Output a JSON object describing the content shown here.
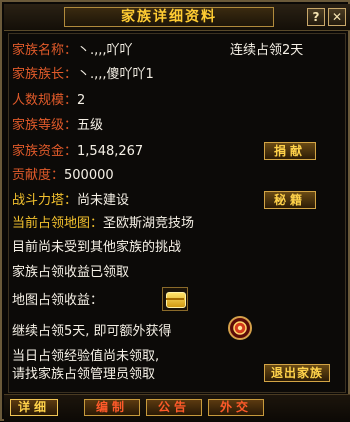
{
  "window": {
    "title": "家族详细资料",
    "help_label": "?",
    "close_label": "✕"
  },
  "info": {
    "family_name_label": "家族名称：",
    "family_name_value": "丶.,,,吖吖",
    "consecutive_label": "连续占领2天",
    "leader_label": "家族族长：",
    "leader_value": "丶.,,,傻吖吖1",
    "size_label": "人数规模：",
    "size_value": "2",
    "level_label": "家族等级：",
    "level_value": "五级",
    "funds_label": "家族资金：",
    "funds_value": "1,548,267",
    "contribution_label": "贡献度：",
    "contribution_value": "500000",
    "hall_label": "战斗力塔：",
    "hall_value": "尚未建设",
    "territory_label": "当前占领地图：",
    "territory_value": "圣欧斯湖竞技场",
    "challenge_text": "目前尚未受到其他家族的挑战",
    "income_received_text": "家族占领收益已领取",
    "map_income_label": "地图占领收益：",
    "continue_text": "继续占领5天, 即可额外获得",
    "exp_text_1": "当日占领经验值尚未领取,",
    "exp_text_2": "请找家族占领管理员领取"
  },
  "buttons": {
    "donate": "捐献",
    "secret": "秘籍",
    "leave": "退出家族"
  },
  "tabs": [
    {
      "label": "详细",
      "active": true
    },
    {
      "label": "编制",
      "active": false
    },
    {
      "label": "公告",
      "active": false
    },
    {
      "label": "外交",
      "active": false
    }
  ],
  "icons": {
    "chest": "treasure-chest-icon",
    "medal": "medal-icon"
  }
}
